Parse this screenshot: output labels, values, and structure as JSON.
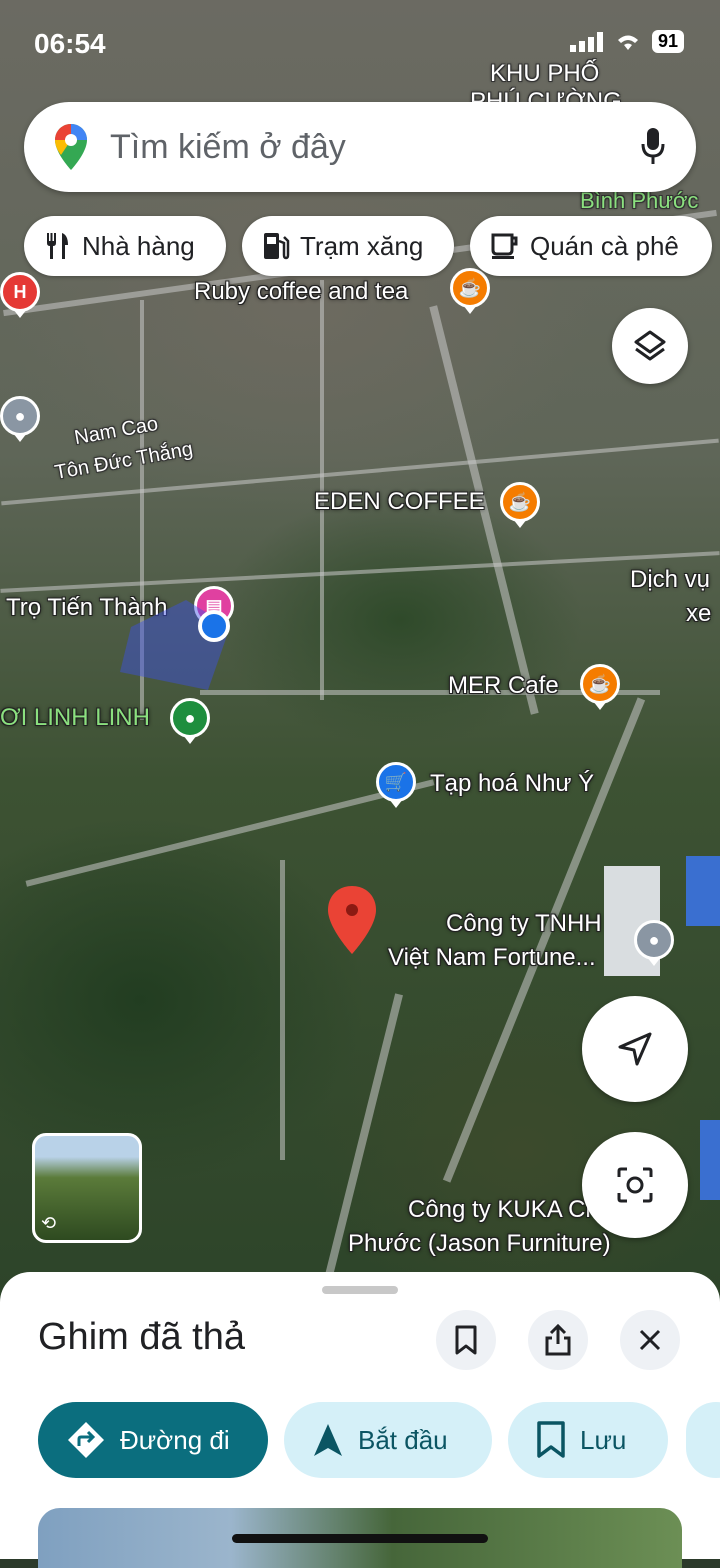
{
  "status": {
    "time": "06:54",
    "battery": "91"
  },
  "search": {
    "placeholder": "Tìm kiếm ở đây"
  },
  "chips": [
    {
      "label": "Nhà hàng",
      "icon": "restaurant-icon"
    },
    {
      "label": "Trạm xăng",
      "icon": "gas-station-icon"
    },
    {
      "label": "Quán cà phê",
      "icon": "cafe-icon"
    }
  ],
  "map": {
    "area_labels": [
      "KHU PHỐ",
      "PHÚ CƯỜNG",
      "Bình Phước"
    ],
    "street_labels": [
      "Nam Cao",
      "Tôn Đức Thắng"
    ],
    "places": {
      "ruby": "Ruby coffee and tea",
      "eden": "EDEN COFFEE",
      "dich_vu_1": "Dịch vụ",
      "dich_vu_2": "xe",
      "tro": "Trọ Tiến Thành",
      "linh": "ƠI LINH LINH",
      "mer": "MER Cafe",
      "tap_hoa": "Tạp hoá Như Ý",
      "fortune_1": "Công ty TNHH",
      "fortune_2": "Việt Nam Fortune...",
      "kuka_1": "Công ty KUKA Ch...em",
      "kuka_2": "Phước (Jason Furniture)"
    },
    "colors": {
      "cafe": "#f57c00",
      "pin": "#ea4335",
      "location": "#1a73e8",
      "hotel": "#e040a0",
      "park": "#1e8e3e",
      "shop": "#1a73e8"
    }
  },
  "sheet": {
    "title": "Ghim đã thả",
    "actions": [
      {
        "label": "Đường đi",
        "icon": "directions-icon"
      },
      {
        "label": "Bắt đầu",
        "icon": "navigation-arrow-icon"
      },
      {
        "label": "Lưu",
        "icon": "bookmark-icon"
      }
    ]
  }
}
